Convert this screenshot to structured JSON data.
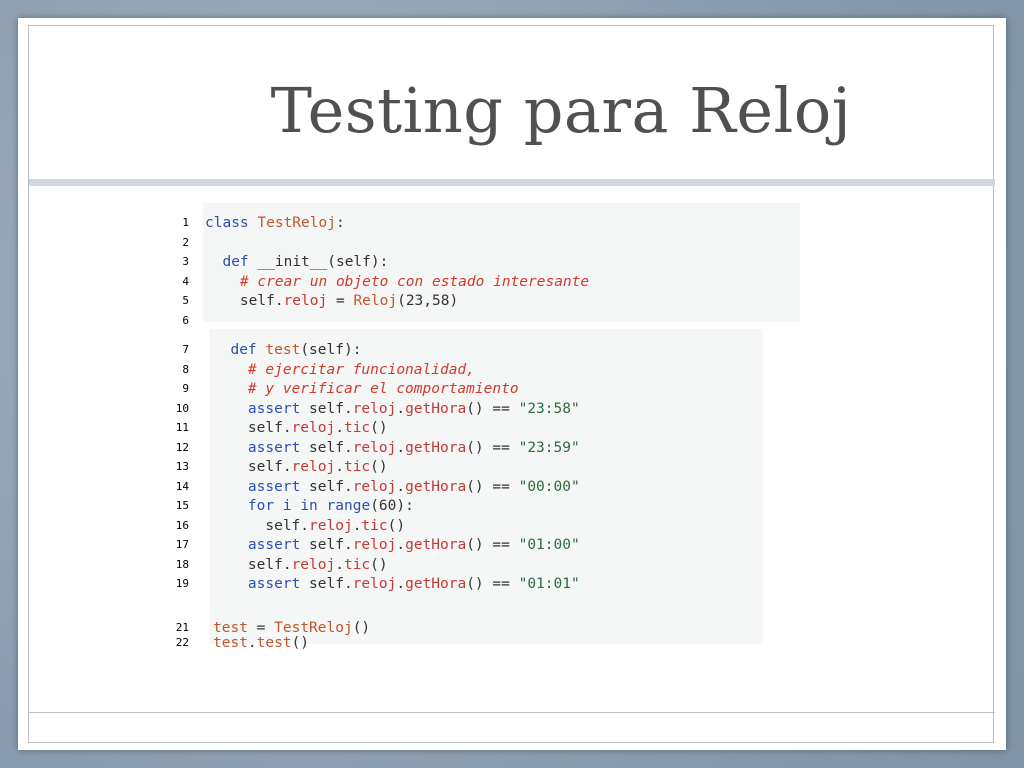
{
  "slide": {
    "title": "Testing para Reloj"
  },
  "code": {
    "lines": [
      {
        "n": "1",
        "tokens": [
          [
            "kw",
            "class"
          ],
          [
            "t",
            " "
          ],
          [
            "cls",
            "TestReloj"
          ],
          [
            "t",
            ":"
          ]
        ]
      },
      {
        "n": "2",
        "tokens": []
      },
      {
        "n": "3",
        "tokens": [
          [
            "t",
            "  "
          ],
          [
            "kw",
            "def"
          ],
          [
            "t",
            " __init__(self):"
          ]
        ]
      },
      {
        "n": "4",
        "tokens": [
          [
            "t",
            "    "
          ],
          [
            "cm",
            "# crear un objeto con estado interesante"
          ]
        ]
      },
      {
        "n": "5",
        "tokens": [
          [
            "t",
            "    self."
          ],
          [
            "attr",
            "reloj"
          ],
          [
            "t",
            " = "
          ],
          [
            "cls",
            "Reloj"
          ],
          [
            "t",
            "(23,58)"
          ]
        ]
      },
      {
        "n": "6",
        "tokens": []
      },
      {
        "n": "7",
        "tokens": [
          [
            "t",
            "  "
          ],
          [
            "kw",
            "def"
          ],
          [
            "t",
            " "
          ],
          [
            "cls",
            "test"
          ],
          [
            "t",
            "(self):"
          ]
        ]
      },
      {
        "n": "8",
        "tokens": [
          [
            "t",
            "    "
          ],
          [
            "cm",
            "# ejercitar funcionalidad,"
          ]
        ]
      },
      {
        "n": "9",
        "tokens": [
          [
            "t",
            "    "
          ],
          [
            "cm",
            "# y verificar el comportamiento"
          ]
        ]
      },
      {
        "n": "10",
        "tokens": [
          [
            "t",
            "    "
          ],
          [
            "kw",
            "assert"
          ],
          [
            "t",
            " self."
          ],
          [
            "attr",
            "reloj"
          ],
          [
            "t",
            "."
          ],
          [
            "attr",
            "getHora"
          ],
          [
            "t",
            "() == "
          ],
          [
            "str",
            "\"23:58\""
          ]
        ]
      },
      {
        "n": "11",
        "tokens": [
          [
            "t",
            "    self."
          ],
          [
            "attr",
            "reloj"
          ],
          [
            "t",
            "."
          ],
          [
            "attr",
            "tic"
          ],
          [
            "t",
            "()"
          ]
        ]
      },
      {
        "n": "12",
        "tokens": [
          [
            "t",
            "    "
          ],
          [
            "kw",
            "assert"
          ],
          [
            "t",
            " self."
          ],
          [
            "attr",
            "reloj"
          ],
          [
            "t",
            "."
          ],
          [
            "attr",
            "getHora"
          ],
          [
            "t",
            "() == "
          ],
          [
            "str",
            "\"23:59\""
          ]
        ]
      },
      {
        "n": "13",
        "tokens": [
          [
            "t",
            "    self."
          ],
          [
            "attr",
            "reloj"
          ],
          [
            "t",
            "."
          ],
          [
            "attr",
            "tic"
          ],
          [
            "t",
            "()"
          ]
        ]
      },
      {
        "n": "14",
        "tokens": [
          [
            "t",
            "    "
          ],
          [
            "kw",
            "assert"
          ],
          [
            "t",
            " self."
          ],
          [
            "attr",
            "reloj"
          ],
          [
            "t",
            "."
          ],
          [
            "attr",
            "getHora"
          ],
          [
            "t",
            "() == "
          ],
          [
            "str",
            "\"00:00\""
          ]
        ]
      },
      {
        "n": "15",
        "tokens": [
          [
            "t",
            "    "
          ],
          [
            "kw",
            "for"
          ],
          [
            "t",
            " "
          ],
          [
            "kw",
            "i"
          ],
          [
            "t",
            " "
          ],
          [
            "kw",
            "in"
          ],
          [
            "t",
            " "
          ],
          [
            "kw",
            "range"
          ],
          [
            "t",
            "(60):"
          ]
        ]
      },
      {
        "n": "16",
        "tokens": [
          [
            "t",
            "      self."
          ],
          [
            "attr",
            "reloj"
          ],
          [
            "t",
            "."
          ],
          [
            "attr",
            "tic"
          ],
          [
            "t",
            "()"
          ]
        ]
      },
      {
        "n": "17",
        "tokens": [
          [
            "t",
            "    "
          ],
          [
            "kw",
            "assert"
          ],
          [
            "t",
            " self."
          ],
          [
            "attr",
            "reloj"
          ],
          [
            "t",
            "."
          ],
          [
            "attr",
            "getHora"
          ],
          [
            "t",
            "() == "
          ],
          [
            "str",
            "\"01:00\""
          ]
        ]
      },
      {
        "n": "18",
        "tokens": [
          [
            "t",
            "    self."
          ],
          [
            "attr",
            "reloj"
          ],
          [
            "t",
            "."
          ],
          [
            "attr",
            "tic"
          ],
          [
            "t",
            "()"
          ]
        ]
      },
      {
        "n": "19",
        "tokens": [
          [
            "t",
            "    "
          ],
          [
            "kw",
            "assert"
          ],
          [
            "t",
            " self."
          ],
          [
            "attr",
            "reloj"
          ],
          [
            "t",
            "."
          ],
          [
            "attr",
            "getHora"
          ],
          [
            "t",
            "() == "
          ],
          [
            "str",
            "\"01:01\""
          ]
        ]
      },
      {
        "n": "",
        "tokens": []
      },
      {
        "n": "21",
        "tokens": [
          [
            "cls",
            "test"
          ],
          [
            "t",
            " = "
          ],
          [
            "cls",
            "TestReloj"
          ],
          [
            "t",
            "()"
          ]
        ]
      },
      {
        "n": "22",
        "tokens": [
          [
            "cls",
            "test"
          ],
          [
            "t",
            "."
          ],
          [
            "cls",
            "test"
          ],
          [
            "t",
            "()"
          ]
        ]
      }
    ]
  },
  "colors": {
    "background": "#8fa2b3",
    "keyword": "#2a4fb0",
    "comment": "#d33a2c",
    "string": "#2e6b3e",
    "attribute": "#c23a36",
    "classname": "#c2572a",
    "code_bg": "#f5f6f6"
  }
}
